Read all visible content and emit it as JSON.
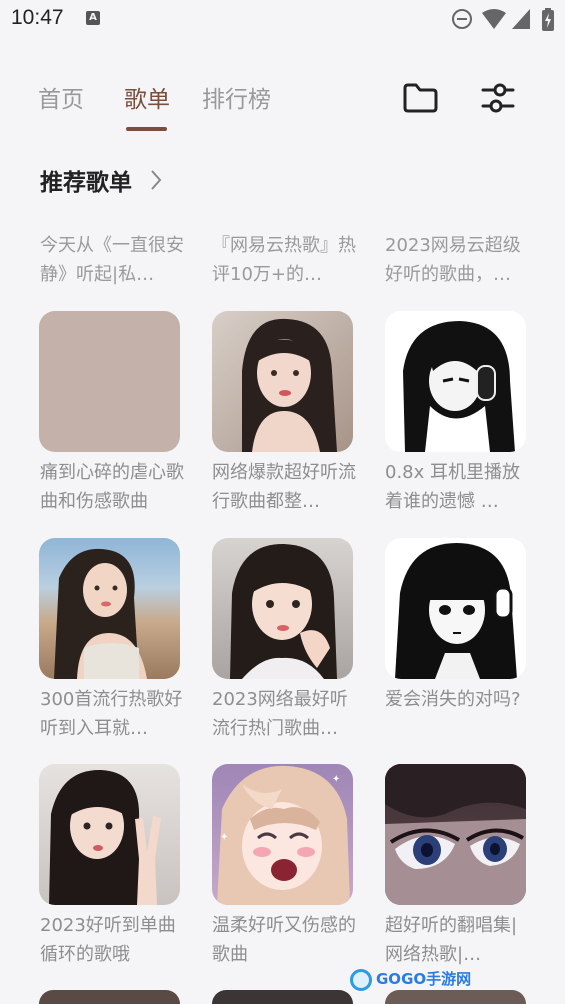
{
  "status": {
    "time": "10:47",
    "a_badge": "A"
  },
  "tabs": [
    {
      "label": "首页"
    },
    {
      "label": "歌单"
    },
    {
      "label": "排行榜"
    }
  ],
  "section": {
    "title": "推荐歌单"
  },
  "top_row": [
    {
      "title": "今天从《一直很安静》听起|私…"
    },
    {
      "title": "『网易云热歌』热评10万+的…"
    },
    {
      "title": "2023网易云超级好听的歌曲，…"
    }
  ],
  "playlists": [
    {
      "title": "痛到心碎的虐心歌曲和伤感歌曲",
      "cover": "blank-tan"
    },
    {
      "title": "网络爆款超好听流行歌曲都整…",
      "cover": "girl-portrait"
    },
    {
      "title": "0.8x 耳机里播放着谁的遗憾 …",
      "cover": "anime-headphones-bw"
    },
    {
      "title": "300首流行热歌好听到入耳就…",
      "cover": "girl-beach"
    },
    {
      "title": "2023网络最好听流行热门歌曲…",
      "cover": "girl-hand-cheek"
    },
    {
      "title": "爱会消失的对吗?",
      "cover": "anime-girl-bw"
    },
    {
      "title": "2023好听到单曲循环的歌哦",
      "cover": "girl-peace-sign"
    },
    {
      "title": "温柔好听又伤感的歌曲",
      "cover": "anime-girl-crying"
    },
    {
      "title": "超好听的翻唱集|网络热歌|…",
      "cover": "anime-eyes-close-up"
    }
  ],
  "watermark": {
    "text": "GOGO手游网"
  },
  "colors": {
    "accent": "#7a4e3c",
    "background": "#f5f5f7",
    "muted_text": "#999999"
  }
}
